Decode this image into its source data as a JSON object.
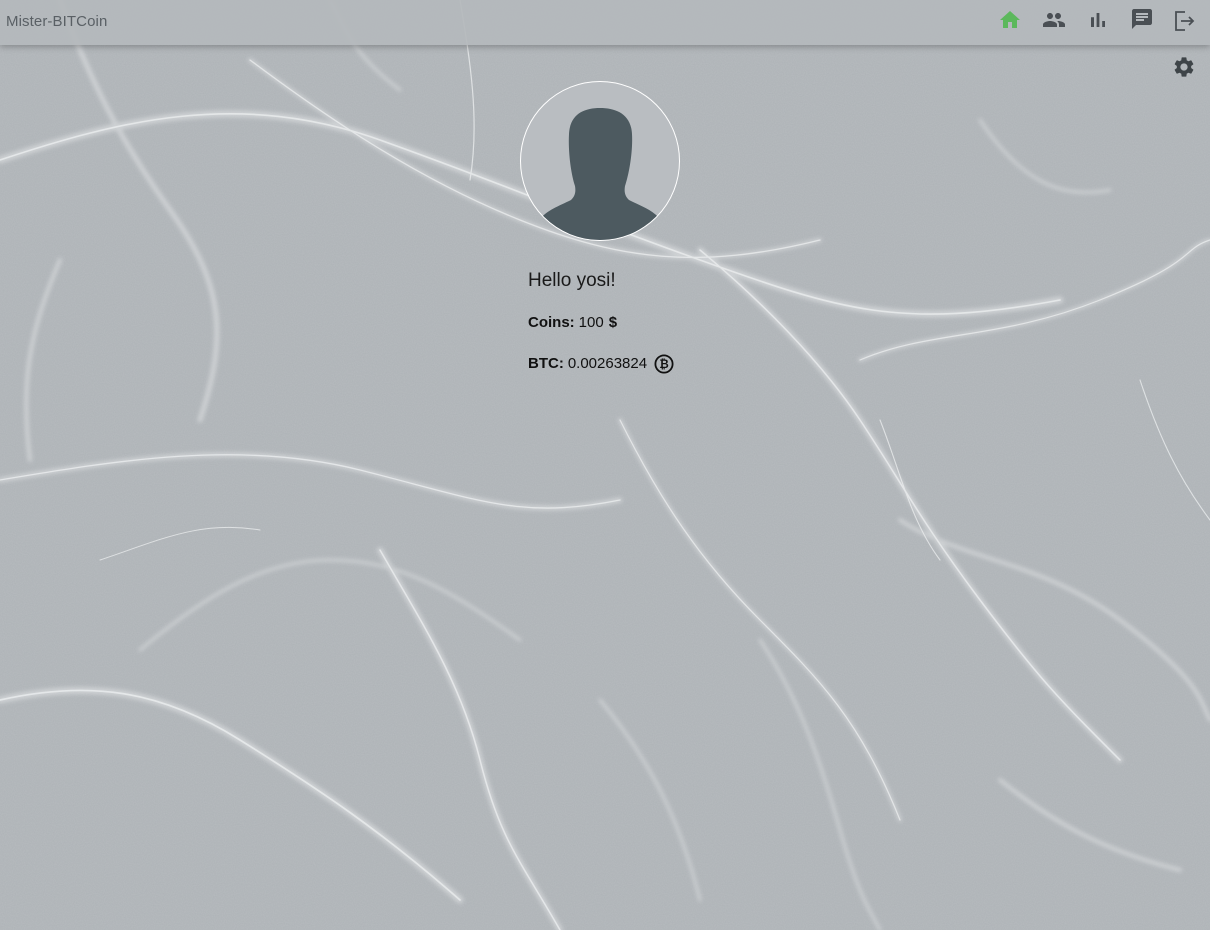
{
  "app": {
    "title": "Mister-BITCoin",
    "accent_color": "#5cb85c"
  },
  "nav": {
    "items": [
      {
        "icon": "home-icon",
        "active": true
      },
      {
        "icon": "contacts-icon",
        "active": false
      },
      {
        "icon": "statistics-icon",
        "active": false
      },
      {
        "icon": "chat-icon",
        "active": false
      },
      {
        "icon": "logout-icon",
        "active": false
      }
    ]
  },
  "settings": {
    "icon": "gear-icon"
  },
  "profile": {
    "greeting": "Hello yosi!",
    "coins_label": "Coins:",
    "coins_value": "100",
    "coins_unit": "$",
    "btc_label": "BTC:",
    "btc_value": "0.00263824",
    "btc_icon": "bitcoin-icon"
  }
}
